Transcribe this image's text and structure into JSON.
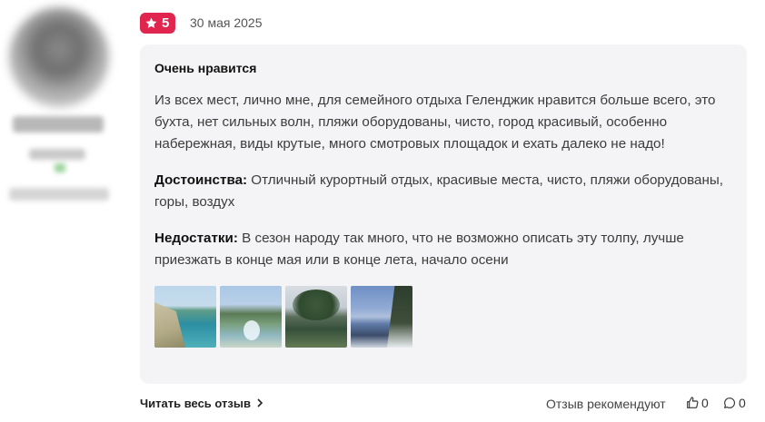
{
  "review": {
    "rating": "5",
    "date": "30 мая 2025",
    "title": "Очень нравится",
    "body": "Из всех мест, лично мне, для семейного отдыха Геленджик нравится больше всего, это бухта, нет сильных волн, пляжи оборудованы, чисто, город красивый, особенно набережная, виды крутые, много смотровых площадок и ехать далеко не надо!",
    "pros_label": "Достоинства:",
    "pros_text": " Отличный курортный отдых, красивые места, чисто, пляжи оборудованы, горы, воздух",
    "cons_label": "Недостатки:",
    "cons_text": " В сезон народу так много, что не возможно описать эту толпу, лучше приезжать в конце мая или в конце лета, начало осени"
  },
  "footer": {
    "read_more": "Читать весь отзыв",
    "recommend": "Отзыв рекомендуют",
    "likes_count": "0",
    "comments_count": "0"
  },
  "colors": {
    "badge": "#e0264f",
    "card_bg": "#f4f4f6"
  },
  "icons": {
    "rating": "star-icon",
    "read_more": "chevron-right-icon",
    "like": "thumbs-up-icon",
    "comment": "comment-icon"
  }
}
